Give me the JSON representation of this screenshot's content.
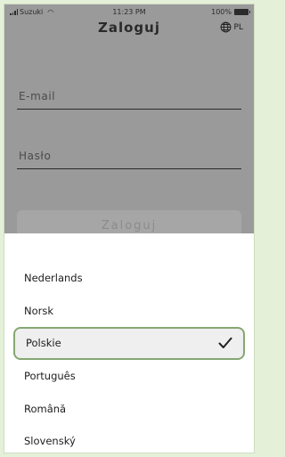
{
  "status_bar": {
    "carrier": "Suzuki",
    "time": "11:23 PM",
    "battery": "100%"
  },
  "header": {
    "title": "Zaloguj",
    "language_code": "PL",
    "language_icon": "globe-icon"
  },
  "form": {
    "email_placeholder": "E-mail",
    "password_placeholder": "Hasło",
    "submit_label": "Zaloguj"
  },
  "language_sheet": {
    "items": [
      {
        "label": "Nederlands",
        "selected": false
      },
      {
        "label": "Norsk",
        "selected": false
      },
      {
        "label": "Polskie",
        "selected": true
      },
      {
        "label": "Português",
        "selected": false
      },
      {
        "label": "Română",
        "selected": false
      },
      {
        "label": "Slovenský",
        "selected": false
      }
    ],
    "selected_icon": "check-icon"
  },
  "colors": {
    "background": "#e5f0d9",
    "overlay": "#9a9a9a",
    "selected_border": "#86a772",
    "selected_fill": "#efefef"
  }
}
